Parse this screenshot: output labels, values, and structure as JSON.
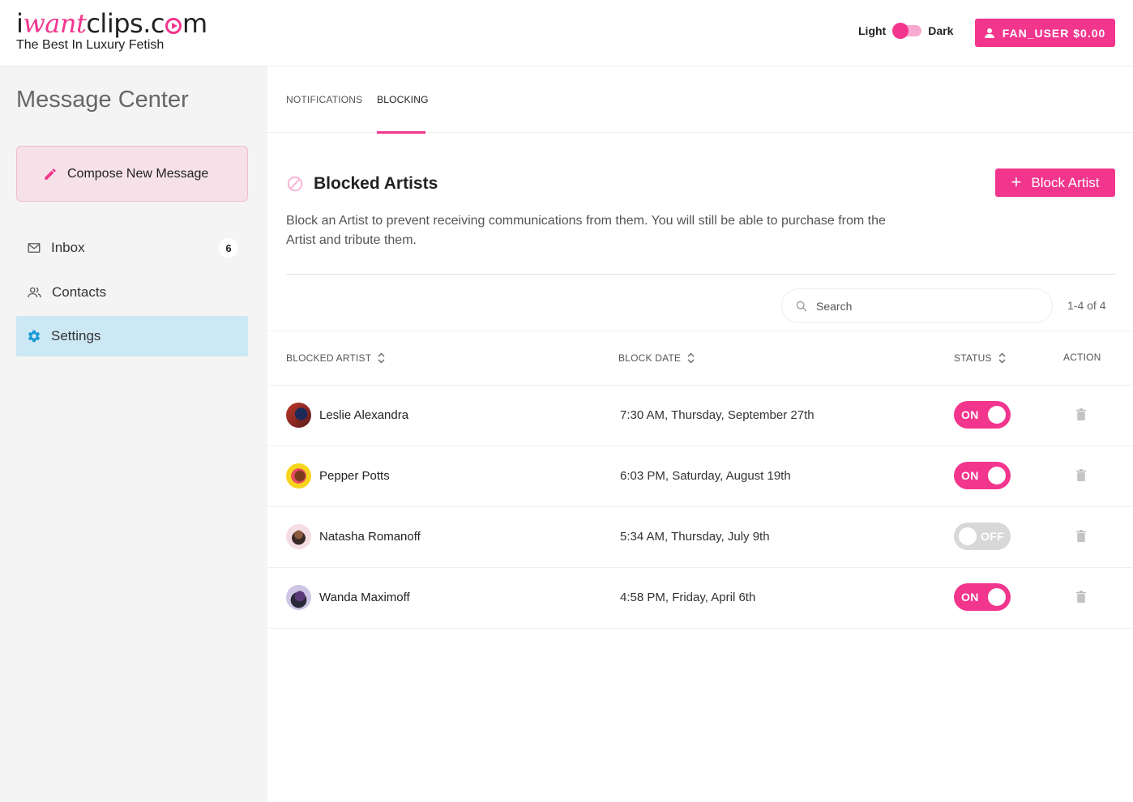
{
  "header": {
    "logo": {
      "part1": "i",
      "part2": "want",
      "part3": "clips.c",
      "part4": "m"
    },
    "tagline": "The Best In Luxury Fetish",
    "theme": {
      "light": "Light",
      "dark": "Dark"
    },
    "user_button": "FAN_USER $0.00"
  },
  "sidebar": {
    "title": "Message Center",
    "compose": "Compose New Message",
    "items": [
      {
        "label": "Inbox",
        "badge": "6"
      },
      {
        "label": "Contacts"
      },
      {
        "label": "Settings"
      }
    ]
  },
  "main": {
    "tabs": [
      {
        "label": "NOTIFICATIONS"
      },
      {
        "label": "BLOCKING"
      }
    ],
    "section_title": "Blocked Artists",
    "block_button": "Block Artist",
    "description": "Block an Artist to prevent receiving communications from them. You will still be able to purchase from the Artist and tribute them.",
    "search_placeholder": "Search",
    "pager": "1-4 of 4",
    "columns": {
      "artist": "BLOCKED ARTIST",
      "date": "BLOCK DATE",
      "status": "STATUS",
      "action": "ACTION"
    },
    "rows": [
      {
        "name": "Leslie Alexandra",
        "date": "7:30 AM, Thursday, September 27th",
        "status": "ON"
      },
      {
        "name": "Pepper Potts",
        "date": "6:03 PM, Saturday, August 19th",
        "status": "ON"
      },
      {
        "name": "Natasha Romanoff",
        "date": "5:34 AM, Thursday, July 9th",
        "status": "OFF"
      },
      {
        "name": "Wanda Maximoff",
        "date": "4:58 PM, Friday, April 6th",
        "status": "ON"
      }
    ]
  },
  "colors": {
    "accent": "#f2358d",
    "accent_light": "#f6e1e9",
    "active_nav": "#cde8f5",
    "settings_icon": "#1a9ad6",
    "switch_off": "#d8d8d8"
  }
}
